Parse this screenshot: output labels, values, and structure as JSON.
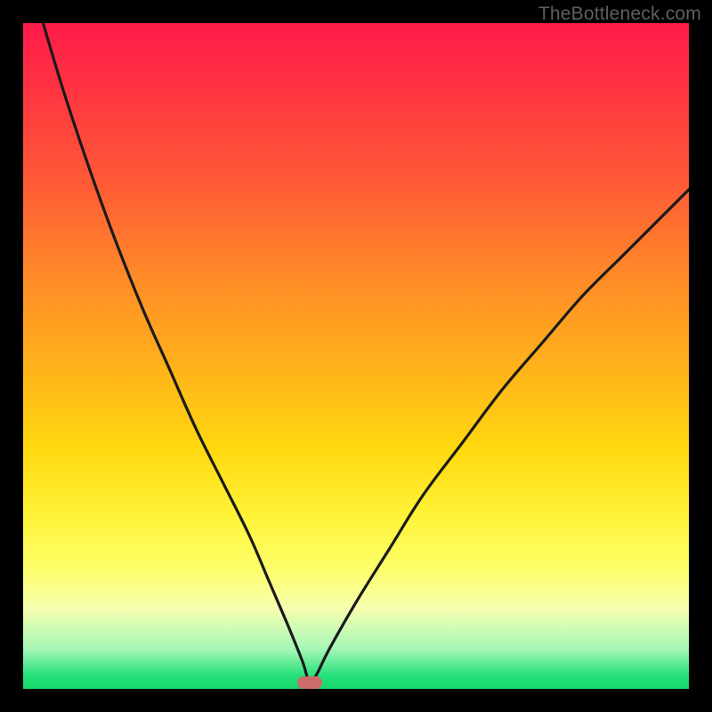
{
  "watermark": "TheBottleneck.com",
  "colors": {
    "frame": "#000000",
    "curve_stroke": "#1a1a1a",
    "marker_fill": "#cc6b6b",
    "gradient_stops": [
      "#ff1a4a",
      "#ff3a40",
      "#ff5a36",
      "#ff8a28",
      "#ffb31a",
      "#ffd80f",
      "#fff338",
      "#fdff6a",
      "#f6ffb0",
      "#a6f7b8",
      "#26e07a",
      "#15d86a"
    ]
  },
  "chart_data": {
    "type": "line",
    "title": "",
    "xlabel": "",
    "ylabel": "",
    "xlim": [
      0,
      100
    ],
    "ylim": [
      0,
      100
    ],
    "marker": {
      "x": 43,
      "y": 1
    },
    "series": [
      {
        "name": "bottleneck-curve",
        "x": [
          3,
          6,
          10,
          14,
          18,
          22,
          26,
          30,
          34,
          37,
          40,
          42,
          43,
          44,
          46,
          50,
          55,
          60,
          66,
          72,
          78,
          84,
          90,
          96,
          100
        ],
        "y": [
          100,
          90,
          78,
          67,
          57,
          48,
          39,
          31,
          23,
          16,
          9,
          4,
          1,
          2,
          6,
          13,
          21,
          29,
          37,
          45,
          52,
          59,
          65,
          71,
          75
        ]
      }
    ]
  }
}
